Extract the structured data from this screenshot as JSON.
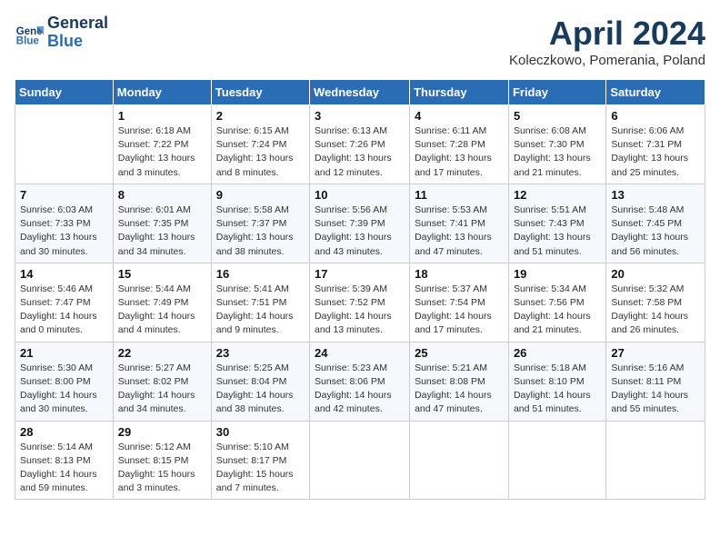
{
  "header": {
    "logo_line1": "General",
    "logo_line2": "Blue",
    "month_title": "April 2024",
    "location": "Koleczkowo, Pomerania, Poland"
  },
  "weekdays": [
    "Sunday",
    "Monday",
    "Tuesday",
    "Wednesday",
    "Thursday",
    "Friday",
    "Saturday"
  ],
  "weeks": [
    [
      {
        "day": "",
        "info": ""
      },
      {
        "day": "1",
        "info": "Sunrise: 6:18 AM\nSunset: 7:22 PM\nDaylight: 13 hours\nand 3 minutes."
      },
      {
        "day": "2",
        "info": "Sunrise: 6:15 AM\nSunset: 7:24 PM\nDaylight: 13 hours\nand 8 minutes."
      },
      {
        "day": "3",
        "info": "Sunrise: 6:13 AM\nSunset: 7:26 PM\nDaylight: 13 hours\nand 12 minutes."
      },
      {
        "day": "4",
        "info": "Sunrise: 6:11 AM\nSunset: 7:28 PM\nDaylight: 13 hours\nand 17 minutes."
      },
      {
        "day": "5",
        "info": "Sunrise: 6:08 AM\nSunset: 7:30 PM\nDaylight: 13 hours\nand 21 minutes."
      },
      {
        "day": "6",
        "info": "Sunrise: 6:06 AM\nSunset: 7:31 PM\nDaylight: 13 hours\nand 25 minutes."
      }
    ],
    [
      {
        "day": "7",
        "info": "Sunrise: 6:03 AM\nSunset: 7:33 PM\nDaylight: 13 hours\nand 30 minutes."
      },
      {
        "day": "8",
        "info": "Sunrise: 6:01 AM\nSunset: 7:35 PM\nDaylight: 13 hours\nand 34 minutes."
      },
      {
        "day": "9",
        "info": "Sunrise: 5:58 AM\nSunset: 7:37 PM\nDaylight: 13 hours\nand 38 minutes."
      },
      {
        "day": "10",
        "info": "Sunrise: 5:56 AM\nSunset: 7:39 PM\nDaylight: 13 hours\nand 43 minutes."
      },
      {
        "day": "11",
        "info": "Sunrise: 5:53 AM\nSunset: 7:41 PM\nDaylight: 13 hours\nand 47 minutes."
      },
      {
        "day": "12",
        "info": "Sunrise: 5:51 AM\nSunset: 7:43 PM\nDaylight: 13 hours\nand 51 minutes."
      },
      {
        "day": "13",
        "info": "Sunrise: 5:48 AM\nSunset: 7:45 PM\nDaylight: 13 hours\nand 56 minutes."
      }
    ],
    [
      {
        "day": "14",
        "info": "Sunrise: 5:46 AM\nSunset: 7:47 PM\nDaylight: 14 hours\nand 0 minutes."
      },
      {
        "day": "15",
        "info": "Sunrise: 5:44 AM\nSunset: 7:49 PM\nDaylight: 14 hours\nand 4 minutes."
      },
      {
        "day": "16",
        "info": "Sunrise: 5:41 AM\nSunset: 7:51 PM\nDaylight: 14 hours\nand 9 minutes."
      },
      {
        "day": "17",
        "info": "Sunrise: 5:39 AM\nSunset: 7:52 PM\nDaylight: 14 hours\nand 13 minutes."
      },
      {
        "day": "18",
        "info": "Sunrise: 5:37 AM\nSunset: 7:54 PM\nDaylight: 14 hours\nand 17 minutes."
      },
      {
        "day": "19",
        "info": "Sunrise: 5:34 AM\nSunset: 7:56 PM\nDaylight: 14 hours\nand 21 minutes."
      },
      {
        "day": "20",
        "info": "Sunrise: 5:32 AM\nSunset: 7:58 PM\nDaylight: 14 hours\nand 26 minutes."
      }
    ],
    [
      {
        "day": "21",
        "info": "Sunrise: 5:30 AM\nSunset: 8:00 PM\nDaylight: 14 hours\nand 30 minutes."
      },
      {
        "day": "22",
        "info": "Sunrise: 5:27 AM\nSunset: 8:02 PM\nDaylight: 14 hours\nand 34 minutes."
      },
      {
        "day": "23",
        "info": "Sunrise: 5:25 AM\nSunset: 8:04 PM\nDaylight: 14 hours\nand 38 minutes."
      },
      {
        "day": "24",
        "info": "Sunrise: 5:23 AM\nSunset: 8:06 PM\nDaylight: 14 hours\nand 42 minutes."
      },
      {
        "day": "25",
        "info": "Sunrise: 5:21 AM\nSunset: 8:08 PM\nDaylight: 14 hours\nand 47 minutes."
      },
      {
        "day": "26",
        "info": "Sunrise: 5:18 AM\nSunset: 8:10 PM\nDaylight: 14 hours\nand 51 minutes."
      },
      {
        "day": "27",
        "info": "Sunrise: 5:16 AM\nSunset: 8:11 PM\nDaylight: 14 hours\nand 55 minutes."
      }
    ],
    [
      {
        "day": "28",
        "info": "Sunrise: 5:14 AM\nSunset: 8:13 PM\nDaylight: 14 hours\nand 59 minutes."
      },
      {
        "day": "29",
        "info": "Sunrise: 5:12 AM\nSunset: 8:15 PM\nDaylight: 15 hours\nand 3 minutes."
      },
      {
        "day": "30",
        "info": "Sunrise: 5:10 AM\nSunset: 8:17 PM\nDaylight: 15 hours\nand 7 minutes."
      },
      {
        "day": "",
        "info": ""
      },
      {
        "day": "",
        "info": ""
      },
      {
        "day": "",
        "info": ""
      },
      {
        "day": "",
        "info": ""
      }
    ]
  ]
}
